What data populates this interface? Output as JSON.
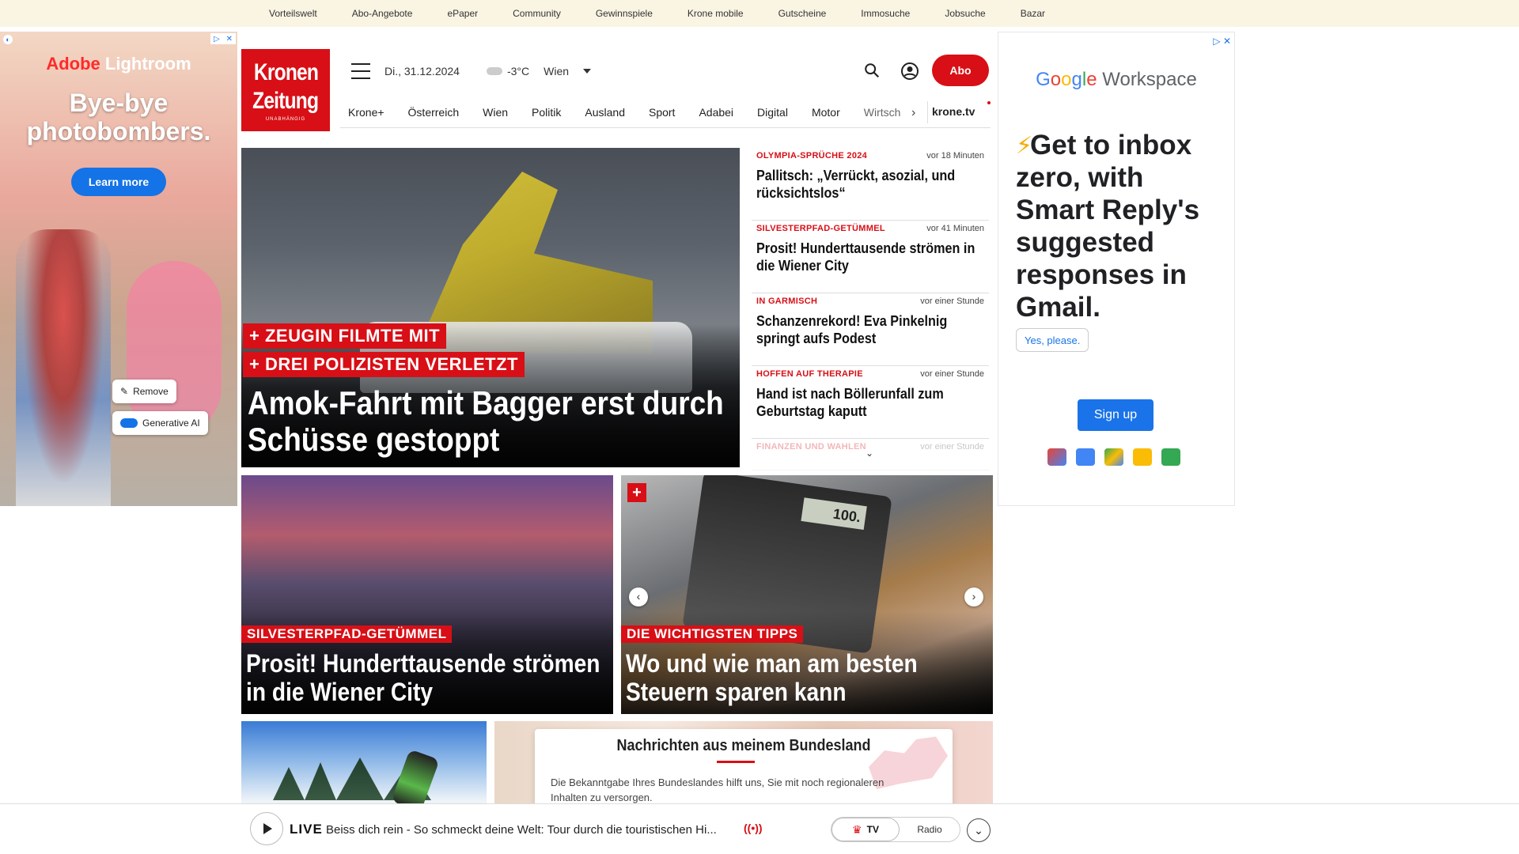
{
  "topbar": {
    "links": [
      "Vorteilswelt",
      "Abo-Angebote",
      "ePaper",
      "Community",
      "Gewinnspiele",
      "Krone mobile",
      "Gutscheine",
      "Immosuche",
      "Jobsuche",
      "Bazar"
    ]
  },
  "ad_left": {
    "brand_prefix": "Adobe",
    "brand_name": "Lightroom",
    "headline": "Bye-bye photobombers.",
    "cta": "Learn more",
    "remove_label": "Remove",
    "genai_label": "Generative AI"
  },
  "header": {
    "logo_line1": "Kronen",
    "logo_line2": "Zeitung",
    "logo_tagline": "UNABHÄNGIG",
    "date": "Di., 31.12.2024",
    "temperature": "-3°C",
    "city": "Wien",
    "abo_label": "Abo"
  },
  "nav": {
    "items": [
      "Krone+",
      "Österreich",
      "Wien",
      "Politik",
      "Ausland",
      "Sport",
      "Adabei",
      "Digital",
      "Motor",
      "Wirtsch"
    ],
    "tv_label": "krone.tv"
  },
  "hero": {
    "tag1": "+ ZEUGIN FILMTE MIT",
    "tag2": "+ DREI POLIZISTEN VERLETZT",
    "headline": "Amok-Fahrt mit Bagger erst durch Schüsse gestoppt"
  },
  "news_list": [
    {
      "kicker": "OLYMPIA-SPRÜCHE 2024",
      "time": "vor 18 Minuten",
      "title": "Pallitsch: „Verrückt, asozial, und rücksichtslos“"
    },
    {
      "kicker": "SILVESTERPFAD-GETÜMMEL",
      "time": "vor 41 Minuten",
      "title": "Prosit! Hunderttausende strömen in die Wiener City"
    },
    {
      "kicker": "IN GARMISCH",
      "time": "vor einer Stunde",
      "title": "Schanzenrekord! Eva Pinkelnig springt aufs Podest"
    },
    {
      "kicker": "HOFFEN AUF THERAPIE",
      "time": "vor einer Stunde",
      "title": "Hand ist nach Böllerunfall zum Geburtstag kaputt"
    },
    {
      "kicker": "FINANZEN UND WAHLEN",
      "time": "vor einer Stunde",
      "title": ""
    }
  ],
  "cards": [
    {
      "tag": "SILVESTERPFAD-GETÜMMEL",
      "headline": "Prosit! Hunderttausende strömen in die Wiener City"
    },
    {
      "tag": "DIE WICHTIGSTEN TIPPS",
      "headline": "Wo und wie man am besten Steuern sparen kann",
      "calc_display": "100."
    }
  ],
  "bundesland": {
    "title": "Nachrichten aus meinem Bundesland",
    "text": "Die Bekanntgabe Ihres Bundeslandes hilft uns, Sie mit noch regionaleren Inhalten zu versorgen."
  },
  "player": {
    "live_label": "LIVE",
    "title": "Beiss dich rein - So schmeckt deine Welt: Tour durch die touristischen Hi...",
    "tv_label": "TV",
    "radio_label": "Radio"
  },
  "ad_right": {
    "brand_g": "G",
    "brand_o1": "o",
    "brand_o2": "o",
    "brand_g2": "g",
    "brand_l": "l",
    "brand_e": "e",
    "brand_suffix": "Workspace",
    "headline": "Get to inbox zero, with Smart Reply's suggested responses in Gmail.",
    "yes_label": "Yes, please.",
    "signup_label": "Sign up"
  }
}
